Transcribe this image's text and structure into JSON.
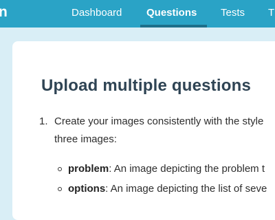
{
  "brand": {
    "text": "n"
  },
  "nav": {
    "items": [
      {
        "label": "Dashboard",
        "active": false
      },
      {
        "label": "Questions",
        "active": true
      },
      {
        "label": "Tests",
        "active": false
      },
      {
        "label": "T",
        "active": false
      }
    ]
  },
  "page": {
    "title": "Upload multiple questions"
  },
  "content": {
    "step": {
      "number": "1.",
      "line1": "Create your images consistently with the style",
      "line2": "three images:"
    },
    "subitems": [
      {
        "term": "problem",
        "text": ": An image depicting the problem t"
      },
      {
        "term": "options",
        "text": ": An image depicting the list of seve"
      }
    ]
  },
  "colors": {
    "topbar": "#2aa3c6",
    "active_underline": "#1d6f8a",
    "background": "#d9eef6",
    "title": "#2f4454"
  }
}
